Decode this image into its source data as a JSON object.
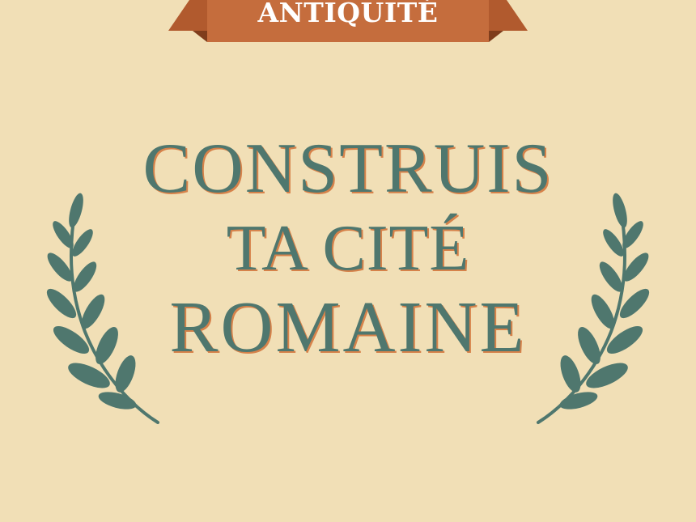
{
  "banner": {
    "label": "ANTIQUITÉ",
    "ribbon_color": "#c56d3d",
    "ribbon_fold_color": "#a8542b"
  },
  "title": {
    "line1": "CONSTRUIS",
    "line2": "TA CITÉ",
    "line3": "ROMAINE",
    "text_color": "#4f776e",
    "shadow_color": "#d6824a"
  },
  "background_color": "#f1dfb6",
  "decorations": {
    "left": "laurel-branch-icon",
    "right": "laurel-branch-icon",
    "color": "#4f776e"
  }
}
